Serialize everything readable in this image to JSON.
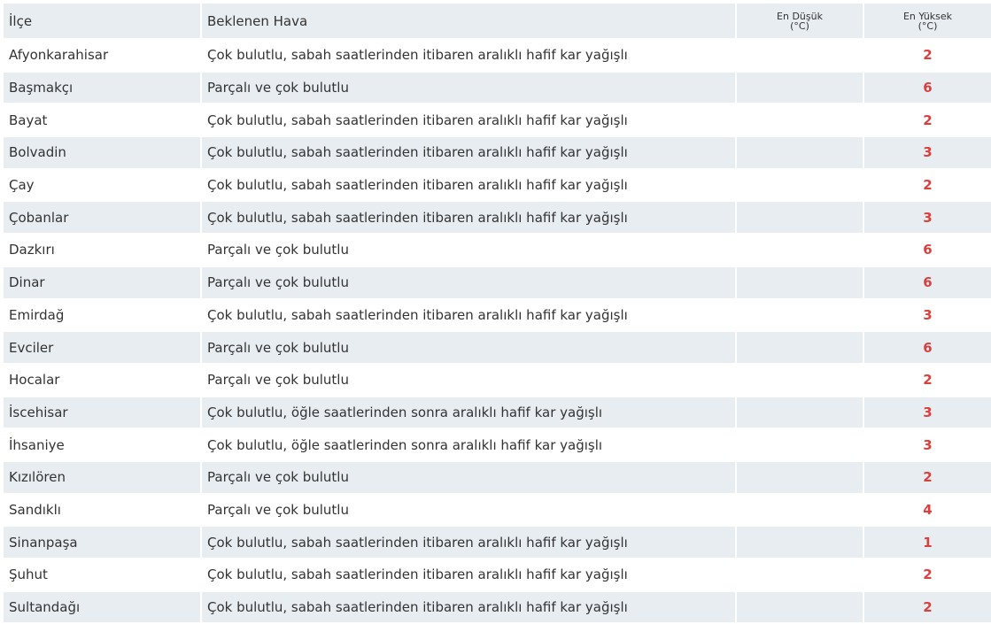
{
  "table": {
    "headers": {
      "district": "İlçe",
      "weather": "Beklenen Hava",
      "min_line1": "En Düşük",
      "min_line2": "(°C)",
      "max_line1": "En Yüksek",
      "max_line2": "(°C)"
    },
    "rows": [
      {
        "district": "Afyonkarahisar",
        "weather": "Çok bulutlu, sabah saatlerinden itibaren aralıklı hafif kar yağışlı",
        "min": "",
        "max": "2"
      },
      {
        "district": "Başmakçı",
        "weather": "Parçalı ve çok bulutlu",
        "min": "",
        "max": "6"
      },
      {
        "district": "Bayat",
        "weather": "Çok bulutlu, sabah saatlerinden itibaren aralıklı hafif kar yağışlı",
        "min": "",
        "max": "2"
      },
      {
        "district": "Bolvadin",
        "weather": "Çok bulutlu, sabah saatlerinden itibaren aralıklı hafif kar yağışlı",
        "min": "",
        "max": "3"
      },
      {
        "district": "Çay",
        "weather": "Çok bulutlu, sabah saatlerinden itibaren aralıklı hafif kar yağışlı",
        "min": "",
        "max": "2"
      },
      {
        "district": "Çobanlar",
        "weather": "Çok bulutlu, sabah saatlerinden itibaren aralıklı hafif kar yağışlı",
        "min": "",
        "max": "3"
      },
      {
        "district": "Dazkırı",
        "weather": "Parçalı ve çok bulutlu",
        "min": "",
        "max": "6"
      },
      {
        "district": "Dinar",
        "weather": "Parçalı ve çok bulutlu",
        "min": "",
        "max": "6"
      },
      {
        "district": "Emirdağ",
        "weather": "Çok bulutlu, sabah saatlerinden itibaren aralıklı hafif kar yağışlı",
        "min": "",
        "max": "3"
      },
      {
        "district": "Evciler",
        "weather": "Parçalı ve çok bulutlu",
        "min": "",
        "max": "6"
      },
      {
        "district": "Hocalar",
        "weather": "Parçalı ve çok bulutlu",
        "min": "",
        "max": "2"
      },
      {
        "district": "İscehisar",
        "weather": "Çok bulutlu, öğle saatlerinden sonra aralıklı hafif kar yağışlı",
        "min": "",
        "max": "3"
      },
      {
        "district": "İhsaniye",
        "weather": "Çok bulutlu, öğle saatlerinden sonra aralıklı hafif kar yağışlı",
        "min": "",
        "max": "3"
      },
      {
        "district": "Kızılören",
        "weather": "Parçalı ve çok bulutlu",
        "min": "",
        "max": "2"
      },
      {
        "district": "Sandıklı",
        "weather": "Parçalı ve çok bulutlu",
        "min": "",
        "max": "4"
      },
      {
        "district": "Sinanpaşa",
        "weather": "Çok bulutlu, sabah saatlerinden itibaren aralıklı hafif kar yağışlı",
        "min": "",
        "max": "1"
      },
      {
        "district": "Şuhut",
        "weather": "Çok bulutlu, sabah saatlerinden itibaren aralıklı hafif kar yağışlı",
        "min": "",
        "max": "2"
      },
      {
        "district": "Sultandağı",
        "weather": "Çok bulutlu, sabah saatlerinden itibaren aralıklı hafif kar yağışlı",
        "min": "",
        "max": "2"
      }
    ]
  },
  "colors": {
    "max_temp": "#d9413f",
    "stripe": "#e8edf1",
    "text": "#333333"
  }
}
